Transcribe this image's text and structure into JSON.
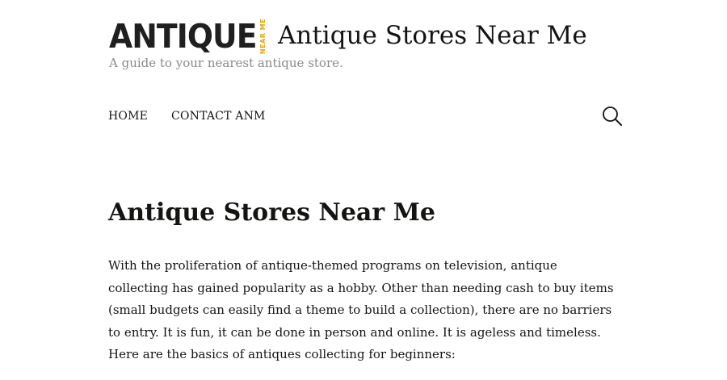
{
  "header": {
    "logo": {
      "word": "ANTIQUE",
      "tag": "NEAR ME"
    },
    "site_title": "Antique Stores Near Me",
    "tagline": "A guide to your nearest antique store."
  },
  "nav": {
    "items": [
      {
        "label": "HOME"
      },
      {
        "label": "CONTACT ANM"
      }
    ],
    "search_icon": "search-icon"
  },
  "main": {
    "title": "Antique Stores Near Me",
    "intro_lines": [
      "With the proliferation of antique-themed programs on television, antique",
      "collecting has gained popularity as a hobby.  Other than needing cash to buy items",
      "(small budgets can easily find a theme to build a collection), there are no barriers",
      "to entry. It is fun, it can be done in person and online. It is ageless and timeless.",
      "Here are the basics of antiques collecting for beginners:"
    ]
  },
  "colors": {
    "text": "#141412",
    "tagline": "#8a8a8a",
    "logo_accent": "#e2a513"
  }
}
